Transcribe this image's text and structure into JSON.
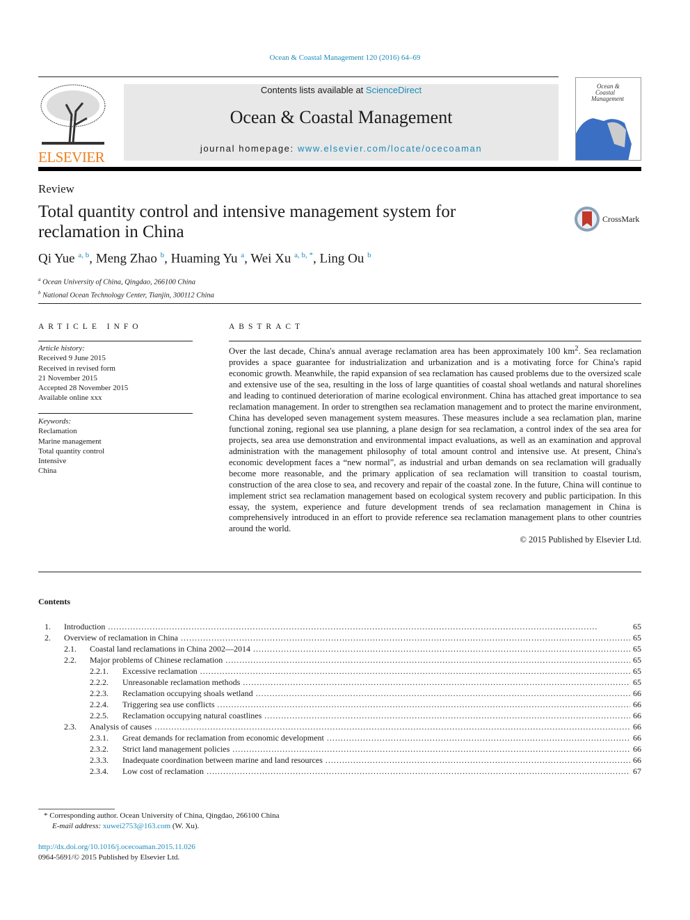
{
  "journal_ref": "Ocean & Coastal Management 120 (2016) 64–69",
  "banner": {
    "contents_prefix": "Contents lists available at ",
    "contents_link": "ScienceDirect",
    "journal_title": "Ocean & Coastal Management",
    "homepage_prefix": "journal homepage: ",
    "homepage_link": "www.elsevier.com/locate/ocecoaman"
  },
  "publisher_logo": "ELSEVIER",
  "cover_title": "Ocean & Coastal Management",
  "article_type": "Review",
  "title": "Total quantity control and intensive management system for reclamation in China",
  "crossmark": "CrossMark",
  "authors": [
    {
      "name": "Qi Yue",
      "aff": "a, b"
    },
    {
      "name": "Meng Zhao",
      "aff": "b"
    },
    {
      "name": "Huaming Yu",
      "aff": "a"
    },
    {
      "name": "Wei Xu",
      "aff": "a, b, *"
    },
    {
      "name": "Ling Ou",
      "aff": "b"
    }
  ],
  "affiliations": [
    {
      "key": "a",
      "text": "Ocean University of China, Qingdao, 266100 China"
    },
    {
      "key": "b",
      "text": "National Ocean Technology Center, Tianjin, 300112 China"
    }
  ],
  "article_info": {
    "heading": "ARTICLE INFO",
    "history_label": "Article history:",
    "history": [
      "Received 9 June 2015",
      "Received in revised form",
      "21 November 2015",
      "Accepted 28 November 2015",
      "Available online xxx"
    ],
    "keywords_label": "Keywords:",
    "keywords": [
      "Reclamation",
      "Marine management",
      "Total quantity control",
      "Intensive",
      "China"
    ]
  },
  "abstract": {
    "heading": "ABSTRACT",
    "text_before_sup": "Over the last decade, China's annual average reclamation area has been approximately 100 km",
    "sup": "2",
    "text": ". Sea reclamation provides a space guarantee for industrialization and urbanization and is a motivating force for China's rapid economic growth. Meanwhile, the rapid expansion of sea reclamation has caused problems due to the oversized scale and extensive use of the sea, resulting in the loss of large quantities of coastal shoal wetlands and natural shorelines and leading to continued deterioration of marine ecological environment. China has attached great importance to sea reclamation management. In order to strengthen sea reclamation management and to protect the marine environment, China has developed seven management system measures. These measures include a sea reclamation plan, marine functional zoning, regional sea use planning, a plane design for sea reclamation, a control index of the sea area for projects, sea area use demonstration and environmental impact evaluations, as well as an examination and approval administration with the management philosophy of total amount control and intensive use. At present, China's economic development faces a “new normal”, as industrial and urban demands on sea reclamation will gradually become more reasonable, and the primary application of sea reclamation will transition to coastal tourism, construction of the area close to sea, and recovery and repair of the coastal zone. In the future, China will continue to implement strict sea reclamation management based on ecological system recovery and public participation. In this essay, the system, experience and future development trends of sea reclamation management in China is comprehensively introduced in an effort to provide reference sea reclamation management plans to other countries around the world.",
    "copyright": "© 2015 Published by Elsevier Ltd."
  },
  "contents": {
    "heading": "Contents",
    "items": [
      {
        "level": 0,
        "num": "1.",
        "title": "Introduction",
        "page": "65"
      },
      {
        "level": 0,
        "num": "2.",
        "title": "Overview of reclamation in China",
        "page": "65"
      },
      {
        "level": 1,
        "num": "2.1.",
        "title": "Coastal land reclamations in China 2002—2014",
        "page": "65"
      },
      {
        "level": 1,
        "num": "2.2.",
        "title": "Major problems of Chinese reclamation",
        "page": "65"
      },
      {
        "level": 2,
        "num": "2.2.1.",
        "title": "Excessive reclamation",
        "page": "65"
      },
      {
        "level": 2,
        "num": "2.2.2.",
        "title": "Unreasonable reclamation methods",
        "page": "65"
      },
      {
        "level": 2,
        "num": "2.2.3.",
        "title": "Reclamation occupying shoals wetland",
        "page": "66"
      },
      {
        "level": 2,
        "num": "2.2.4.",
        "title": "Triggering sea use conflicts",
        "page": "66"
      },
      {
        "level": 2,
        "num": "2.2.5.",
        "title": "Reclamation occupying natural coastlines",
        "page": "66"
      },
      {
        "level": 1,
        "num": "2.3.",
        "title": "Analysis of causes",
        "page": "66"
      },
      {
        "level": 2,
        "num": "2.3.1.",
        "title": "Great demands for reclamation from economic development",
        "page": "66"
      },
      {
        "level": 2,
        "num": "2.3.2.",
        "title": "Strict land management policies",
        "page": "66"
      },
      {
        "level": 2,
        "num": "2.3.3.",
        "title": "Inadequate coordination between marine and land resources",
        "page": "66"
      },
      {
        "level": 2,
        "num": "2.3.4.",
        "title": "Low cost of reclamation",
        "page": "67"
      }
    ]
  },
  "footnote": {
    "marker": "*",
    "text": "Corresponding author. Ocean University of China, Qingdao, 266100 China",
    "email_label": "E-mail address: ",
    "email": "xuwei2753@163.com",
    "email_suffix": " (W. Xu)."
  },
  "doi": "http://dx.doi.org/10.1016/j.ocecoaman.2015.11.026",
  "issn": "0964-5691/© 2015 Published by Elsevier Ltd.",
  "colors": {
    "link": "#1a8ab8",
    "elsevier_orange": "#f07e1b",
    "banner_bg": "#e8e8e8"
  }
}
